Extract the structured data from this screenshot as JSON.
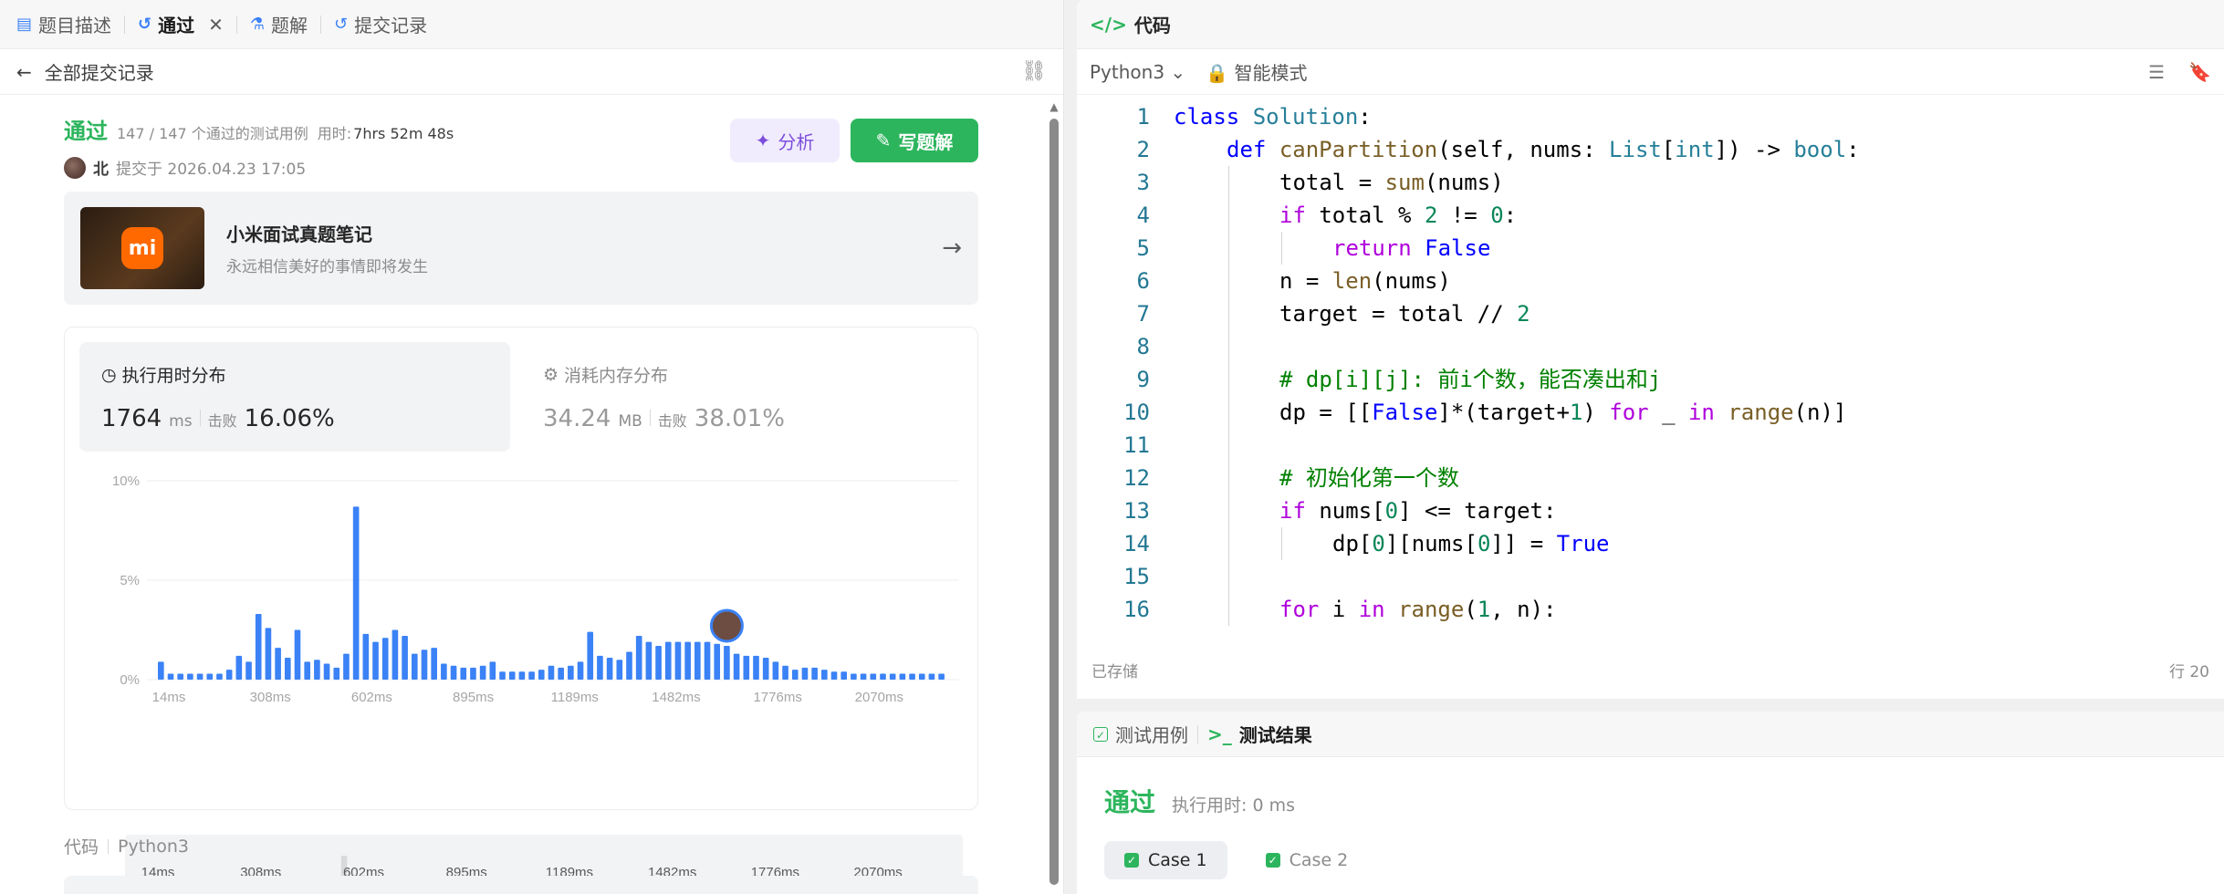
{
  "tabs": [
    {
      "label": "题目描述",
      "icon": "document-icon"
    },
    {
      "label": "通过",
      "icon": "history-icon"
    },
    {
      "label": "题解",
      "icon": "flask-icon"
    },
    {
      "label": "提交记录",
      "icon": "history-icon"
    }
  ],
  "subbar": {
    "back_label": "全部提交记录"
  },
  "submission": {
    "status": "通过",
    "tests": "147 / 147 个通过的测试用例",
    "time_label": "用时:",
    "time_value": "7hrs 52m 48s",
    "user": "北",
    "submitted_at": "提交于 2026.04.23 17:05",
    "analyze_label": "分析",
    "write_label": "写题解"
  },
  "promo": {
    "logo_text": "mi",
    "title": "小米面试真题笔记",
    "subtitle": "永远相信美好的事情即将发生"
  },
  "perf": {
    "runtime": {
      "title": "执行用时分布",
      "value": "1764",
      "unit": "ms",
      "beats_label": "击败",
      "beats": "16.06%"
    },
    "memory": {
      "title": "消耗内存分布",
      "value": "34.24",
      "unit": "MB",
      "beats_label": "击败",
      "beats": "38.01%"
    }
  },
  "chart_data": {
    "type": "bar",
    "y_ticks": [
      "10%",
      "5%",
      "0%"
    ],
    "ylim": [
      0,
      10
    ],
    "x_ticks": [
      "14ms",
      "308ms",
      "602ms",
      "895ms",
      "1189ms",
      "1482ms",
      "1776ms",
      "2070ms"
    ],
    "values": [
      0.9,
      0.3,
      0.3,
      0.3,
      0.3,
      0.3,
      0.3,
      0.5,
      1.2,
      0.9,
      3.3,
      2.6,
      1.6,
      1.1,
      2.5,
      0.9,
      1.0,
      0.8,
      0.6,
      1.3,
      8.7,
      2.3,
      1.9,
      2.1,
      2.5,
      2.2,
      1.3,
      1.5,
      1.6,
      0.8,
      0.7,
      0.6,
      0.6,
      0.7,
      0.9,
      0.4,
      0.4,
      0.4,
      0.4,
      0.5,
      0.7,
      0.6,
      0.7,
      0.9,
      2.4,
      1.2,
      1.1,
      1.0,
      1.4,
      2.2,
      1.9,
      1.7,
      1.9,
      1.9,
      1.9,
      1.9,
      1.9,
      1.8,
      1.7,
      1.3,
      1.2,
      1.2,
      1.1,
      0.9,
      0.7,
      0.5,
      0.6,
      0.6,
      0.5,
      0.4,
      0.4,
      0.3,
      0.3,
      0.3,
      0.3,
      0.3,
      0.3,
      0.3,
      0.3,
      0.3,
      0.3
    ],
    "highlight_index": 58,
    "bar_color": "#3b82f6"
  },
  "code_section": {
    "label": "代码",
    "lang": "Python3"
  },
  "editor": {
    "title": "代码",
    "language": "Python3",
    "mode": "智能模式",
    "saved": "已存储",
    "position": "行 20",
    "lines": [
      {
        "n": "1",
        "indent": 0,
        "html": "<span class='kw2'>class</span> <span class='cls'>Solution</span>:"
      },
      {
        "n": "2",
        "indent": 1,
        "html": "<span class='kw2'>def</span> <span class='fn'>canPartition</span>(self, nums: <span class='cls'>List</span>[<span class='cls'>int</span>]) -> <span class='cls'>bool</span>:"
      },
      {
        "n": "3",
        "indent": 2,
        "html": "total = <span class='fn'>sum</span>(nums)"
      },
      {
        "n": "4",
        "indent": 2,
        "html": "<span class='kw'>if</span> total % <span class='num'>2</span> != <span class='num'>0</span>:"
      },
      {
        "n": "5",
        "indent": 3,
        "html": "<span class='kw'>return</span> <span class='kw2'>False</span>"
      },
      {
        "n": "6",
        "indent": 2,
        "html": "n = <span class='fn'>len</span>(nums)"
      },
      {
        "n": "7",
        "indent": 2,
        "html": "target = total // <span class='num'>2</span>"
      },
      {
        "n": "8",
        "indent": 2,
        "html": ""
      },
      {
        "n": "9",
        "indent": 2,
        "html": "<span class='cm'># dp[i][j]: 前i个数，能否凑出和j</span>"
      },
      {
        "n": "10",
        "indent": 2,
        "html": "dp = [[<span class='kw2'>False</span>]*(target+<span class='num'>1</span>) <span class='kw'>for</span> _ <span class='kw'>in</span> <span class='fn'>range</span>(n)]"
      },
      {
        "n": "11",
        "indent": 2,
        "html": ""
      },
      {
        "n": "12",
        "indent": 2,
        "html": "<span class='cm'># 初始化第一个数</span>"
      },
      {
        "n": "13",
        "indent": 2,
        "html": "<span class='kw'>if</span> nums[<span class='num'>0</span>] <= target:"
      },
      {
        "n": "14",
        "indent": 3,
        "html": "dp[<span class='num'>0</span>][nums[<span class='num'>0</span>]] = <span class='kw2'>True</span>"
      },
      {
        "n": "15",
        "indent": 2,
        "html": ""
      },
      {
        "n": "16",
        "indent": 2,
        "html": "<span class='kw'>for</span> i <span class='kw'>in</span> <span class='fn'>range</span>(<span class='num'>1</span>, n):"
      }
    ]
  },
  "results": {
    "tab_cases": "测试用例",
    "tab_results": "测试结果",
    "status": "通过",
    "runtime": "执行用时: 0 ms",
    "cases": [
      "Case 1",
      "Case 2"
    ]
  }
}
